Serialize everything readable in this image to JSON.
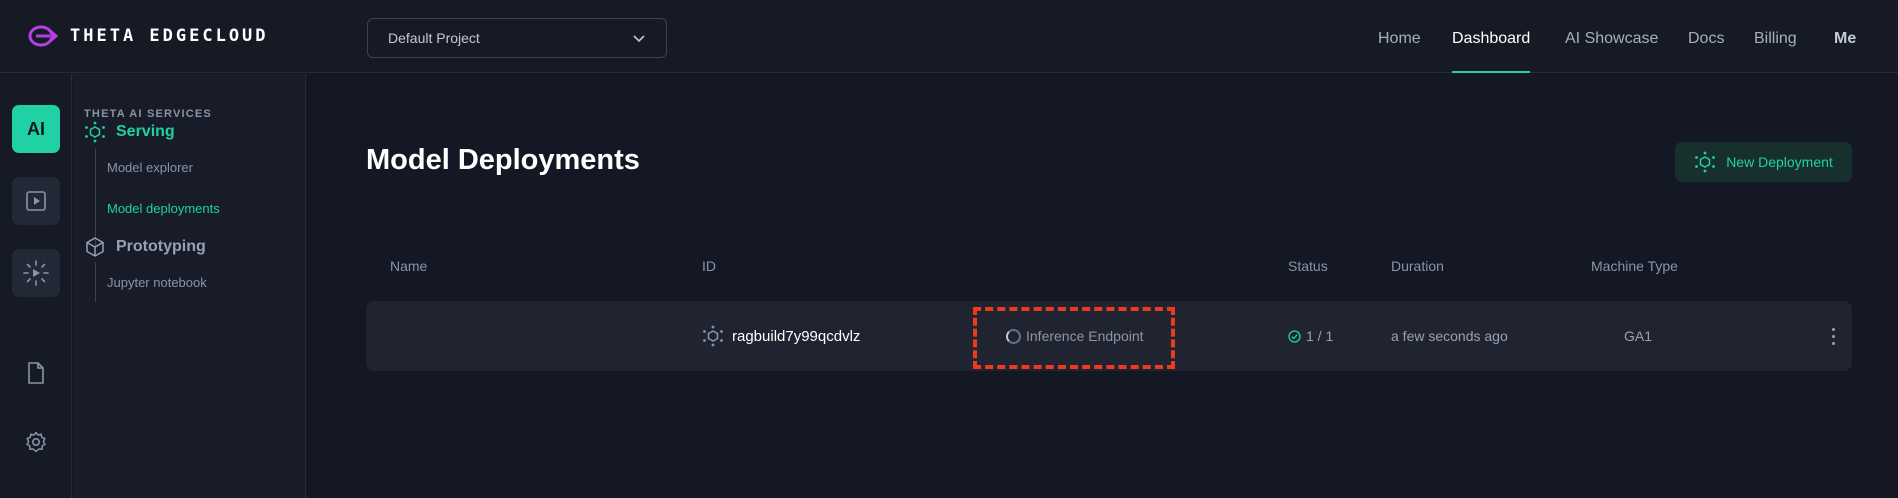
{
  "header": {
    "logo_text": "THETA EDGECLOUD",
    "project_select": {
      "value": "Default Project"
    },
    "nav": [
      {
        "label": "Home",
        "active": false
      },
      {
        "label": "Dashboard",
        "active": true
      },
      {
        "label": "AI Showcase",
        "active": false
      },
      {
        "label": "Docs",
        "active": false
      },
      {
        "label": "Billing",
        "active": false
      },
      {
        "label": "Me",
        "active": false
      }
    ]
  },
  "rail": {
    "ai_label": "AI",
    "icons": [
      "ai-services",
      "video-play-icon",
      "sparkle-icon",
      "document-icon",
      "settings-gear-icon"
    ]
  },
  "subnav": {
    "section_title": "THETA AI SERVICES",
    "groups": [
      {
        "label": "Serving",
        "icon": "serving-hub-icon",
        "active": true,
        "items": [
          {
            "label": "Model explorer",
            "active": false
          },
          {
            "label": "Model deployments",
            "active": true
          }
        ]
      },
      {
        "label": "Prototyping",
        "icon": "cube-icon",
        "active": false,
        "items": [
          {
            "label": "Jupyter notebook",
            "active": false
          }
        ]
      }
    ]
  },
  "main": {
    "title": "Model Deployments",
    "new_button": {
      "label": "New Deployment",
      "icon": "deploy-hub-icon"
    },
    "columns": [
      "Name",
      "ID",
      "Status",
      "Duration",
      "Machine Type"
    ],
    "rows": [
      {
        "name": "",
        "id": "ragbuild7y99qcdvlz",
        "endpoint": "Inference Endpoint",
        "status": "1 / 1",
        "duration": "a few seconds ago",
        "machine_type": "GA1"
      }
    ]
  },
  "colors": {
    "accent": "#1fd1a5",
    "background": "#141824",
    "row_background": "#1f2430",
    "highlight": "#ec3a1f"
  }
}
